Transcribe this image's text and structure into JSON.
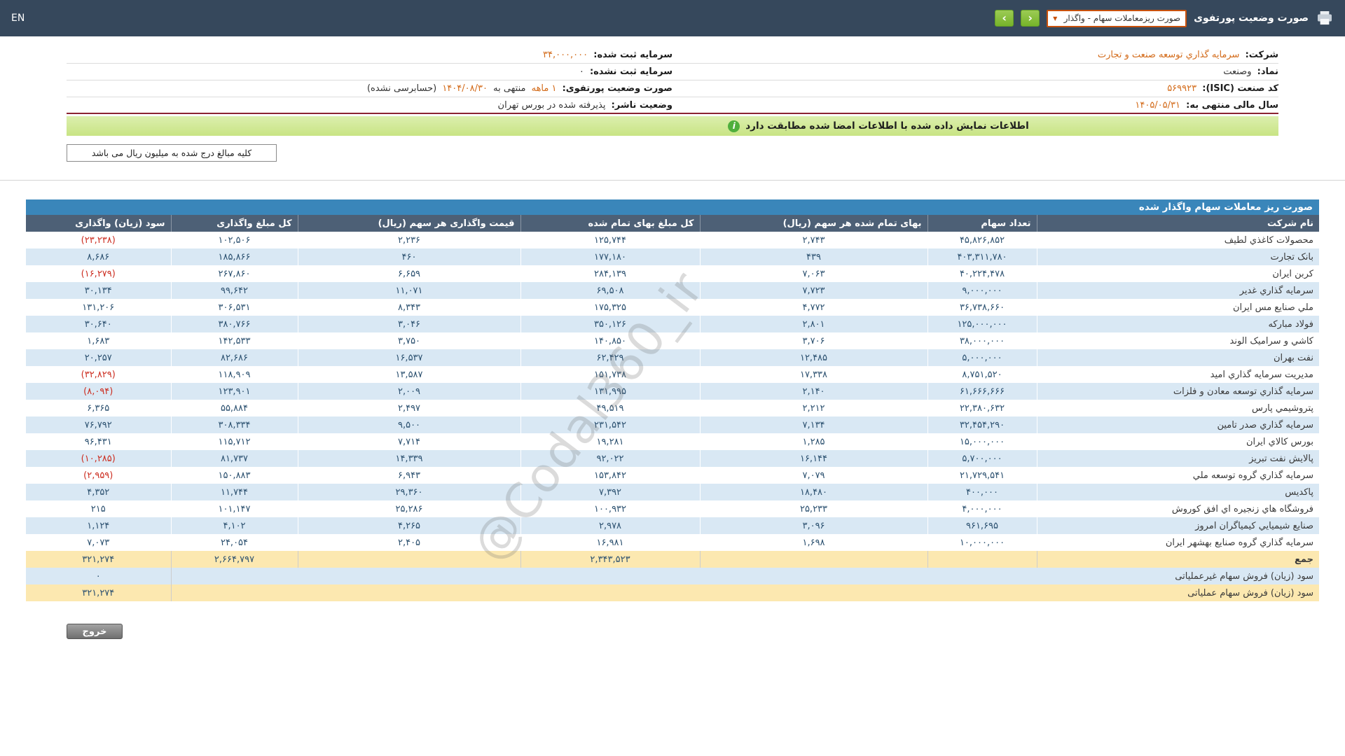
{
  "topbar": {
    "en": "EN",
    "title": "صورت وضعیت پورتفوی",
    "report_dropdown": "صورت ریزمعاملات سهام - واگذار",
    "nav_forward": "›",
    "nav_back": "‹"
  },
  "info": {
    "company_label": "شرکت:",
    "company_value": "سرمایه گذاري توسعه صنعت و تجارت",
    "registered_capital_label": "سرمایه ثبت شده:",
    "registered_capital_value": "۳۴,۰۰۰,۰۰۰",
    "symbol_label": "نماد:",
    "symbol_value": "وصنعت",
    "unregistered_capital_label": "سرمایه ثبت نشده:",
    "unregistered_capital_value": "۰",
    "isic_label": "کد صنعت (ISIC):",
    "isic_value": "۵۶۹۹۲۳",
    "portfolio_label": "صورت وضعیت پورتفوی:",
    "portfolio_period": "۱ ماهه",
    "portfolio_middle": "منتهی به",
    "portfolio_date": "۱۴۰۴/۰۸/۳۰",
    "portfolio_suffix": "(حسابرسی نشده)",
    "fiscal_year_label": "سال مالی منتهی به:",
    "fiscal_year_value": "۱۴۰۵/۰۵/۳۱",
    "issuer_status_label": "وضعیت ناشر:",
    "issuer_status_value": "پذیرفته شده در بورس تهران"
  },
  "banner": {
    "text": "اطلاعات نمایش داده شده با اطلاعات امضا شده مطابقت دارد"
  },
  "note": {
    "text": "کلیه مبالغ درج شده به میلیون ریال می باشد"
  },
  "table": {
    "title": "صورت ریز معاملات سهام واگذار شده",
    "headers": [
      "نام شرکت",
      "تعداد سهام",
      "بهای تمام شده هر سهم (ریال)",
      "کل مبلغ بهای تمام شده",
      "قیمت واگذاری هر سهم (ریال)",
      "کل مبلغ واگذاری",
      "سود (زیان) واگذاری"
    ],
    "rows": [
      [
        "محصولات کاغذي لطیف",
        "۴۵,۸۲۶,۸۵۲",
        "۲,۷۴۳",
        "۱۲۵,۷۴۴",
        "۲,۲۳۶",
        "۱۰۲,۵۰۶",
        "(۲۳,۲۳۸)"
      ],
      [
        "بانک تجارت",
        "۴۰۳,۳۱۱,۷۸۰",
        "۴۳۹",
        "۱۷۷,۱۸۰",
        "۴۶۰",
        "۱۸۵,۸۶۶",
        "۸,۶۸۶"
      ],
      [
        "کربن ایران",
        "۴۰,۲۲۴,۴۷۸",
        "۷,۰۶۳",
        "۲۸۴,۱۳۹",
        "۶,۶۵۹",
        "۲۶۷,۸۶۰",
        "(۱۶,۲۷۹)"
      ],
      [
        "سرمایه گذاري غدیر",
        "۹,۰۰۰,۰۰۰",
        "۷,۷۲۳",
        "۶۹,۵۰۸",
        "۱۱,۰۷۱",
        "۹۹,۶۴۲",
        "۳۰,۱۳۴"
      ],
      [
        "ملي صنایع مس ایران",
        "۳۶,۷۳۸,۶۶۰",
        "۴,۷۷۲",
        "۱۷۵,۳۲۵",
        "۸,۳۴۳",
        "۳۰۶,۵۳۱",
        "۱۳۱,۲۰۶"
      ],
      [
        "فولاد مبارکه",
        "۱۲۵,۰۰۰,۰۰۰",
        "۲,۸۰۱",
        "۳۵۰,۱۲۶",
        "۳,۰۴۶",
        "۳۸۰,۷۶۶",
        "۳۰,۶۴۰"
      ],
      [
        "کاشي و سرامیک الوند",
        "۳۸,۰۰۰,۰۰۰",
        "۳,۷۰۶",
        "۱۴۰,۸۵۰",
        "۳,۷۵۰",
        "۱۴۲,۵۳۳",
        "۱,۶۸۳"
      ],
      [
        "نفت بهران",
        "۵,۰۰۰,۰۰۰",
        "۱۲,۴۸۵",
        "۶۲,۴۲۹",
        "۱۶,۵۳۷",
        "۸۲,۶۸۶",
        "۲۰,۲۵۷"
      ],
      [
        "مدیریت سرمایه گذاري امید",
        "۸,۷۵۱,۵۲۰",
        "۱۷,۳۳۸",
        "۱۵۱,۷۳۸",
        "۱۳,۵۸۷",
        "۱۱۸,۹۰۹",
        "(۳۲,۸۲۹)"
      ],
      [
        "سرمایه گذاري توسعه معادن و فلزات",
        "۶۱,۶۶۶,۶۶۶",
        "۲,۱۴۰",
        "۱۳۱,۹۹۵",
        "۲,۰۰۹",
        "۱۲۳,۹۰۱",
        "(۸,۰۹۴)"
      ],
      [
        "پتروشیمي پارس",
        "۲۲,۳۸۰,۶۳۲",
        "۲,۲۱۲",
        "۴۹,۵۱۹",
        "۲,۴۹۷",
        "۵۵,۸۸۴",
        "۶,۳۶۵"
      ],
      [
        "سرمایه گذاري صدر تامین",
        "۳۲,۴۵۴,۲۹۰",
        "۷,۱۳۴",
        "۲۳۱,۵۴۲",
        "۹,۵۰۰",
        "۳۰۸,۳۳۴",
        "۷۶,۷۹۲"
      ],
      [
        "بورس کالاي ایران",
        "۱۵,۰۰۰,۰۰۰",
        "۱,۲۸۵",
        "۱۹,۲۸۱",
        "۷,۷۱۴",
        "۱۱۵,۷۱۲",
        "۹۶,۴۳۱"
      ],
      [
        "پالایش نفت تبریز",
        "۵,۷۰۰,۰۰۰",
        "۱۶,۱۴۴",
        "۹۲,۰۲۲",
        "۱۴,۳۳۹",
        "۸۱,۷۳۷",
        "(۱۰,۲۸۵)"
      ],
      [
        "سرمایه گذاري گروه توسعه ملي",
        "۲۱,۷۲۹,۵۴۱",
        "۷,۰۷۹",
        "۱۵۳,۸۴۲",
        "۶,۹۴۳",
        "۱۵۰,۸۸۳",
        "(۲,۹۵۹)"
      ],
      [
        "پاکدیس",
        "۴۰۰,۰۰۰",
        "۱۸,۴۸۰",
        "۷,۳۹۲",
        "۲۹,۳۶۰",
        "۱۱,۷۴۴",
        "۴,۳۵۲"
      ],
      [
        "فروشگاه هاي زنجیره اي افق کوروش",
        "۴,۰۰۰,۰۰۰",
        "۲۵,۲۳۳",
        "۱۰۰,۹۳۲",
        "۲۵,۲۸۶",
        "۱۰۱,۱۴۷",
        "۲۱۵"
      ],
      [
        "صنایع شیمیایي کیمیاگران امروز",
        "۹۶۱,۶۹۵",
        "۳,۰۹۶",
        "۲,۹۷۸",
        "۴,۲۶۵",
        "۴,۱۰۲",
        "۱,۱۲۴"
      ],
      [
        "سرمایه گذاري گروه صنایع بهشهر ایران",
        "۱۰,۰۰۰,۰۰۰",
        "۱,۶۹۸",
        "۱۶,۹۸۱",
        "۲,۴۰۵",
        "۲۴,۰۵۴",
        "۷,۰۷۳"
      ]
    ],
    "total_row": {
      "label": "جمع",
      "total_cost": "۲,۳۴۳,۵۲۳",
      "total_transfer": "۲,۶۶۴,۷۹۷",
      "profit": "۳۲۱,۲۷۴"
    },
    "non_operating_row": {
      "label": "سود (زیان) فروش سهام غیرعملیاتی",
      "value": "۰"
    },
    "operating_row": {
      "label": "سود (زیان) فروش سهام عملیاتی",
      "value": "۳۲۱,۲۷۴"
    }
  },
  "exit_button": "خروج",
  "watermark": "@Codal360_ir",
  "colors": {
    "topbar-bg": "#36485c",
    "dropdown-border": "#c9510c",
    "accent-green": "#9ccb54",
    "value-orange": "#d36b1a",
    "banner-green": "#c8e484",
    "divider-maroon": "#8b2332",
    "table-title-blue": "#3a86ba",
    "table-header-slate": "#4d6076",
    "row-alt-blue": "#d9e8f4",
    "summary-cream": "#fce8b0",
    "number-blue": "#2c5170",
    "negative-red": "#cc2e21"
  }
}
